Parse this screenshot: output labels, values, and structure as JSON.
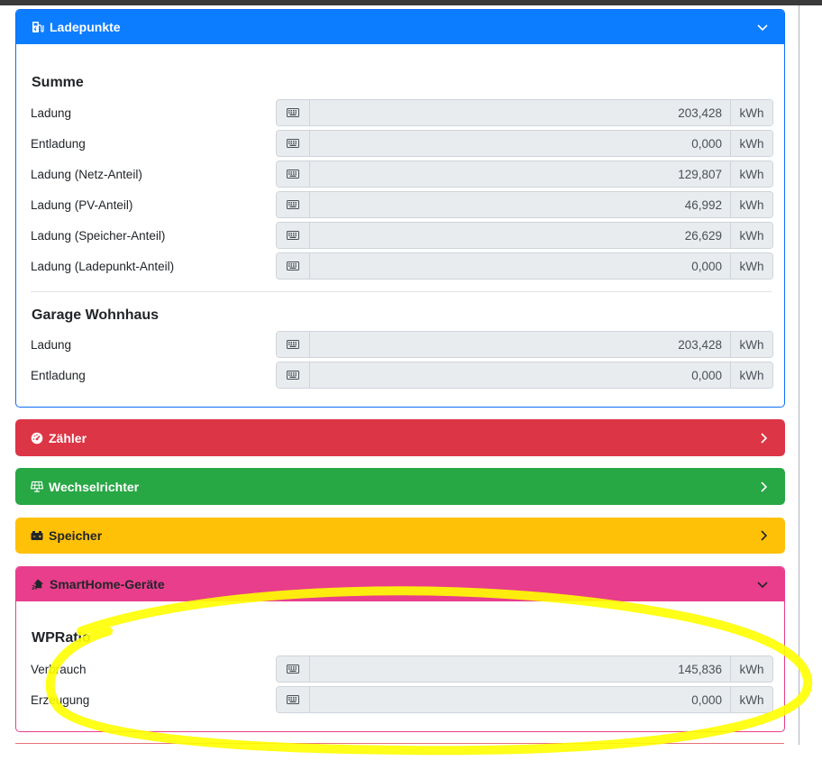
{
  "colors": {
    "blue": "#0d7dff",
    "red": "#dc3545",
    "green": "#28a745",
    "yellow": "#ffc107",
    "pink": "#e83e8c",
    "highlight": "#ffff00"
  },
  "ladepunkte": {
    "title": "Ladepunkte",
    "icon": "charging-station-icon",
    "sections": [
      {
        "title": "Summe",
        "rows": [
          {
            "label": "Ladung",
            "value": "203,428",
            "unit": "kWh"
          },
          {
            "label": "Entladung",
            "value": "0,000",
            "unit": "kWh"
          },
          {
            "label": "Ladung (Netz-Anteil)",
            "value": "129,807",
            "unit": "kWh"
          },
          {
            "label": "Ladung (PV-Anteil)",
            "value": "46,992",
            "unit": "kWh"
          },
          {
            "label": "Ladung (Speicher-Anteil)",
            "value": "26,629",
            "unit": "kWh"
          },
          {
            "label": "Ladung (Ladepunkt-Anteil)",
            "value": "0,000",
            "unit": "kWh"
          }
        ]
      },
      {
        "title": "Garage Wohnhaus",
        "rows": [
          {
            "label": "Ladung",
            "value": "203,428",
            "unit": "kWh"
          },
          {
            "label": "Entladung",
            "value": "0,000",
            "unit": "kWh"
          }
        ]
      }
    ]
  },
  "zaehler": {
    "title": "Zähler",
    "icon": "gauge-icon"
  },
  "wechselrichter": {
    "title": "Wechselrichter",
    "icon": "solar-panel-icon"
  },
  "speicher": {
    "title": "Speicher",
    "icon": "car-battery-icon"
  },
  "smarthome": {
    "title": "SmartHome-Geräte",
    "icon": "house-signal-icon",
    "sections": [
      {
        "title": "WPRatio",
        "rows": [
          {
            "label": "Verbrauch",
            "value": "145,836",
            "unit": "kWh"
          },
          {
            "label": "Erzeugung",
            "value": "0,000",
            "unit": "kWh"
          }
        ]
      }
    ]
  }
}
